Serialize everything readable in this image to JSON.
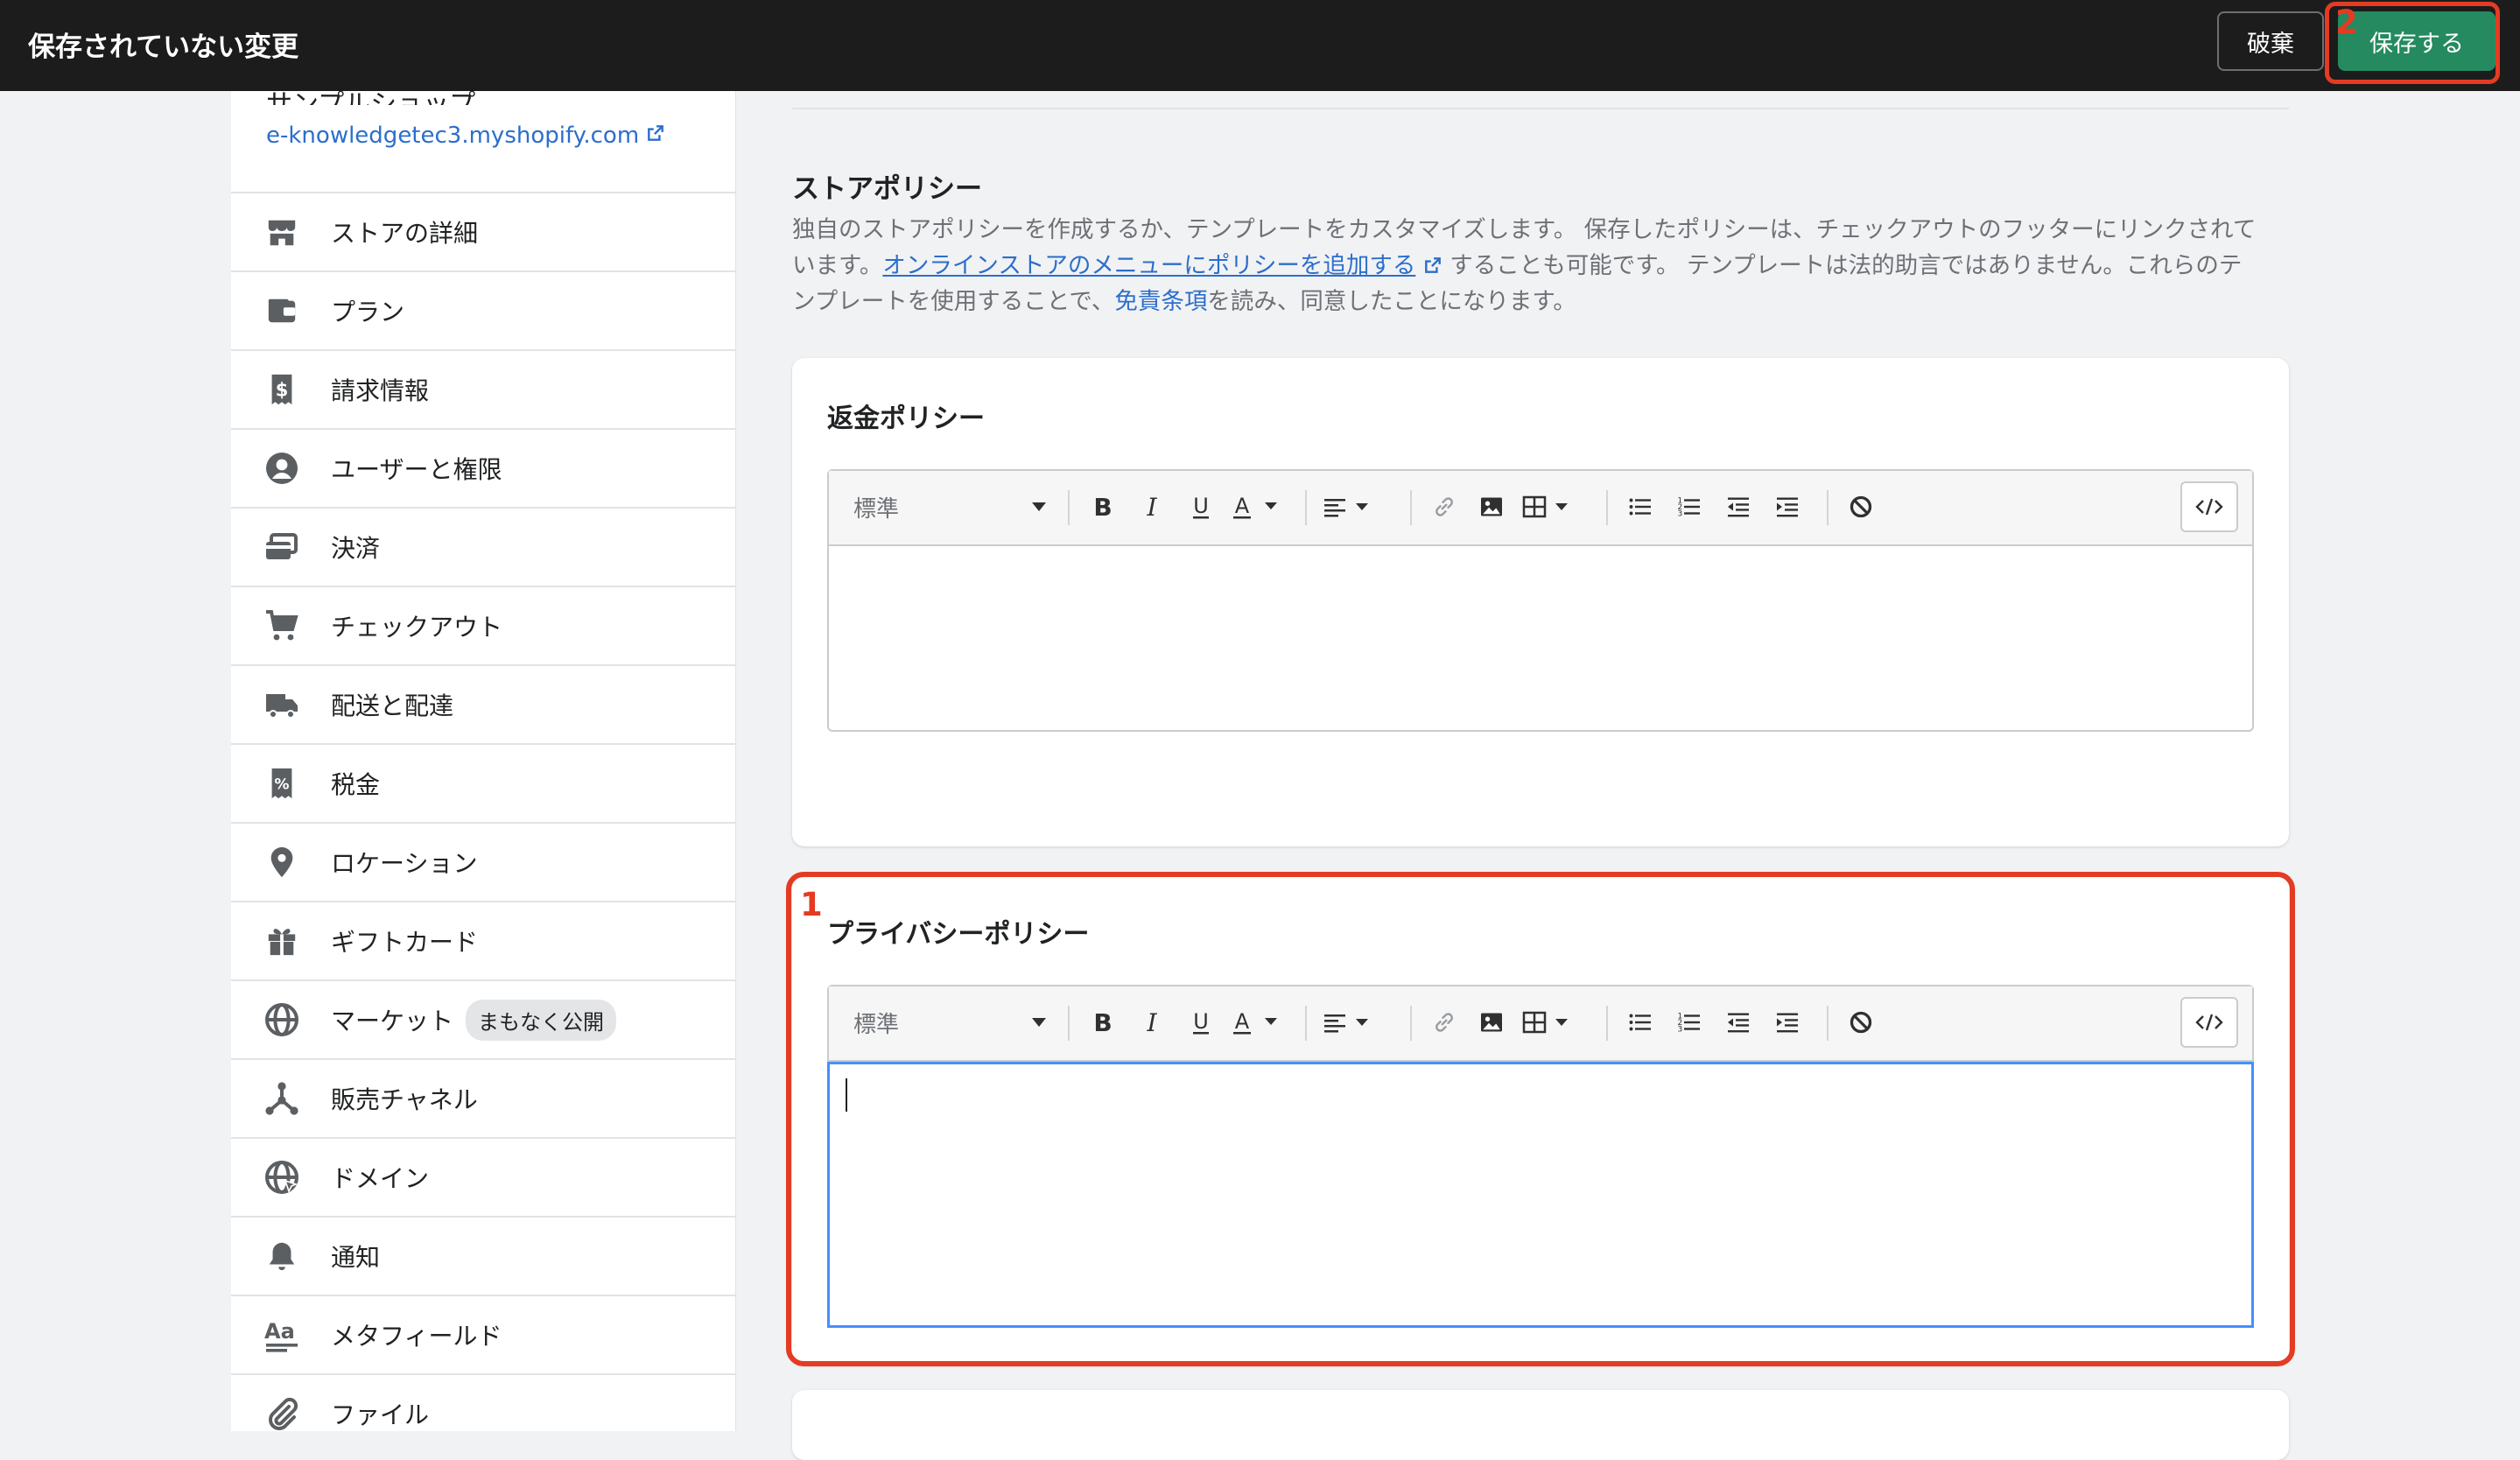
{
  "topbar": {
    "title": "保存されていない変更",
    "discard_label": "破棄",
    "save_label": "保存する"
  },
  "annotations": {
    "step1": "1",
    "step2": "2"
  },
  "sidebar": {
    "store_name": "サンプルショップ",
    "store_url": "e-knowledgetec3.myshopify.com",
    "items": [
      {
        "label": "ストアの詳細",
        "icon": "store-icon"
      },
      {
        "label": "プラン",
        "icon": "wallet-icon"
      },
      {
        "label": "請求情報",
        "icon": "billing-icon"
      },
      {
        "label": "ユーザーと権限",
        "icon": "user-icon"
      },
      {
        "label": "決済",
        "icon": "payments-icon"
      },
      {
        "label": "チェックアウト",
        "icon": "cart-icon"
      },
      {
        "label": "配送と配達",
        "icon": "truck-icon"
      },
      {
        "label": "税金",
        "icon": "tax-icon"
      },
      {
        "label": "ロケーション",
        "icon": "location-icon"
      },
      {
        "label": "ギフトカード",
        "icon": "gift-icon"
      },
      {
        "label": "マーケット",
        "icon": "globe-icon",
        "badge": "まもなく公開"
      },
      {
        "label": "販売チャネル",
        "icon": "channels-icon"
      },
      {
        "label": "ドメイン",
        "icon": "domain-icon"
      },
      {
        "label": "通知",
        "icon": "bell-icon"
      },
      {
        "label": "メタフィールド",
        "icon": "metafields-icon"
      },
      {
        "label": "ファイル",
        "icon": "paperclip-icon"
      }
    ]
  },
  "main": {
    "section_title": "ストアポリシー",
    "desc_part1": "独自のストアポリシーを作成するか、テンプレートをカスタマイズします。 保存したポリシーは、チェックアウトのフッターにリンクされています。",
    "desc_link1": "オンラインストアのメニューにポリシーを追加する",
    "desc_part2": " することも可能です。 テンプレートは法的助言ではありません。これらのテンプレートを使用することで、",
    "desc_link2": "免責条項",
    "desc_part3": "を読み、同意したことになります。",
    "refund_title": "返金ポリシー",
    "privacy_title": "プライバシーポリシー",
    "editor": {
      "style_select": "標準",
      "colors": {
        "focus": "#458fff",
        "highlight": "#e43b23",
        "save": "#258a5f"
      }
    }
  }
}
